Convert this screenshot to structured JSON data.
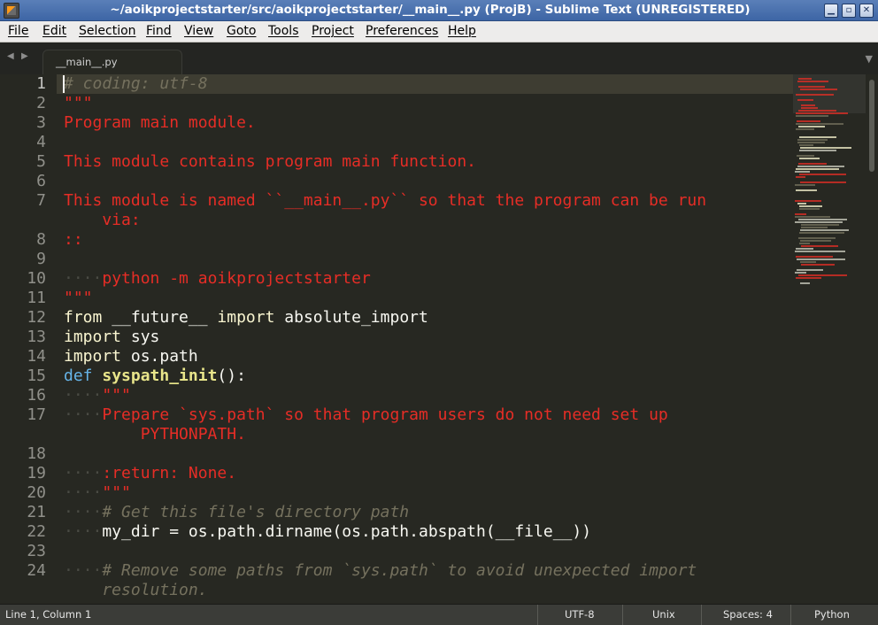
{
  "window": {
    "title": "~/aoikprojectstarter/src/aoikprojectstarter/__main__.py (ProjB) - Sublime Text (UNREGISTERED)",
    "minimize_glyph": "▁",
    "maximize_glyph": "▫",
    "close_glyph": "✕"
  },
  "menu": [
    "File",
    "Edit",
    "Selection",
    "Find",
    "View",
    "Goto",
    "Tools",
    "Project",
    "Preferences",
    "Help"
  ],
  "tabs": {
    "back_glyph": "◀",
    "forward_glyph": "▶",
    "active_label": "__main__.py",
    "overflow_glyph": "▼"
  },
  "editor": {
    "language": "Python",
    "lines": [
      {
        "num": "1",
        "tokens": [
          {
            "c": "cmt",
            "t": "# coding: utf-8"
          }
        ]
      },
      {
        "num": "2",
        "tokens": [
          {
            "c": "str",
            "t": "\"\"\""
          }
        ]
      },
      {
        "num": "3",
        "tokens": [
          {
            "c": "str",
            "t": "Program main module."
          }
        ]
      },
      {
        "num": "4",
        "tokens": []
      },
      {
        "num": "5",
        "tokens": [
          {
            "c": "str",
            "t": "This module contains program main function."
          }
        ]
      },
      {
        "num": "6",
        "tokens": []
      },
      {
        "num": "7",
        "tokens": [
          {
            "c": "str",
            "t": "This module is named ``__main__.py`` so that the program can be run"
          }
        ]
      },
      {
        "num": "",
        "tokens": [
          {
            "c": "str",
            "t": "    via:"
          }
        ]
      },
      {
        "num": "8",
        "tokens": [
          {
            "c": "str",
            "t": "::"
          }
        ]
      },
      {
        "num": "9",
        "tokens": []
      },
      {
        "num": "10",
        "tokens": [
          {
            "c": "ws",
            "t": "····"
          },
          {
            "c": "str",
            "t": "python -m aoikprojectstarter"
          }
        ]
      },
      {
        "num": "11",
        "tokens": [
          {
            "c": "str",
            "t": "\"\"\""
          }
        ]
      },
      {
        "num": "12",
        "tokens": [
          {
            "c": "kw",
            "t": "from"
          },
          {
            "c": "",
            "t": " __future__ "
          },
          {
            "c": "kw",
            "t": "import"
          },
          {
            "c": "",
            "t": " absolute_import"
          }
        ]
      },
      {
        "num": "13",
        "tokens": [
          {
            "c": "kw",
            "t": "import"
          },
          {
            "c": "",
            "t": " sys"
          }
        ]
      },
      {
        "num": "14",
        "tokens": [
          {
            "c": "kw",
            "t": "import"
          },
          {
            "c": "",
            "t": " os.path"
          }
        ]
      },
      {
        "num": "15",
        "tokens": [
          {
            "c": "def",
            "t": "def"
          },
          {
            "c": "",
            "t": " "
          },
          {
            "c": "fn",
            "t": "syspath_init"
          },
          {
            "c": "",
            "t": "():"
          }
        ]
      },
      {
        "num": "16",
        "tokens": [
          {
            "c": "ws",
            "t": "····"
          },
          {
            "c": "str",
            "t": "\"\"\""
          }
        ]
      },
      {
        "num": "17",
        "tokens": [
          {
            "c": "ws",
            "t": "····"
          },
          {
            "c": "str",
            "t": "Prepare `sys.path` so that program users do not need set up"
          }
        ]
      },
      {
        "num": "",
        "tokens": [
          {
            "c": "str",
            "t": "        PYTHONPATH."
          }
        ]
      },
      {
        "num": "18",
        "tokens": []
      },
      {
        "num": "19",
        "tokens": [
          {
            "c": "ws",
            "t": "····"
          },
          {
            "c": "str",
            "t": ":return: None."
          }
        ]
      },
      {
        "num": "20",
        "tokens": [
          {
            "c": "ws",
            "t": "····"
          },
          {
            "c": "str",
            "t": "\"\"\""
          }
        ]
      },
      {
        "num": "21",
        "tokens": [
          {
            "c": "ws",
            "t": "····"
          },
          {
            "c": "cmt",
            "t": "# Get this file's directory path"
          }
        ]
      },
      {
        "num": "22",
        "tokens": [
          {
            "c": "ws",
            "t": "····"
          },
          {
            "c": "",
            "t": "my_dir = os.path.dirname(os.path.abspath(__file__))"
          }
        ]
      },
      {
        "num": "23",
        "tokens": []
      },
      {
        "num": "24",
        "tokens": [
          {
            "c": "ws",
            "t": "····"
          },
          {
            "c": "cmt",
            "t": "# Remove some paths from `sys.path` to avoid unexpected import"
          }
        ]
      },
      {
        "num": "",
        "tokens": [
          {
            "c": "cmt",
            "t": "    resolution."
          }
        ]
      }
    ]
  },
  "status": {
    "position": "Line 1, Column 1",
    "encoding": "UTF-8",
    "line_endings": "Unix",
    "indentation": "Spaces: 4",
    "syntax": "Python"
  },
  "colors": {
    "background": "#272822",
    "comment": "#75715e",
    "string": "#e62d26",
    "keyword": "#f9f5d0",
    "def": "#66b4e8",
    "function": "#e8e58a",
    "titlebar": "#4a72b0"
  }
}
